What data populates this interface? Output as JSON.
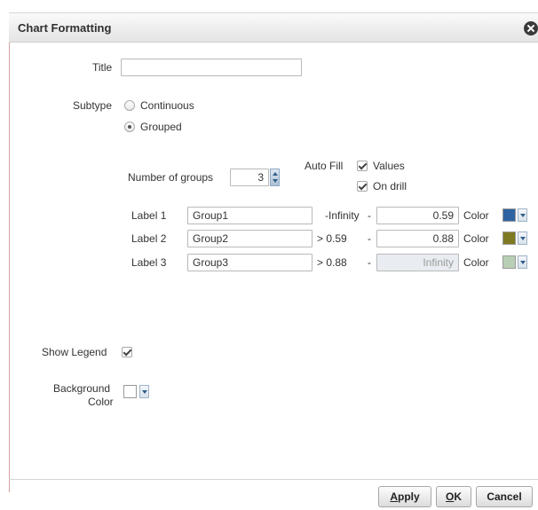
{
  "dialog": {
    "title": "Chart Formatting"
  },
  "form": {
    "title_label": "Title",
    "title_value": "",
    "subtype_label": "Subtype",
    "subtype_options": [
      "Continuous",
      "Grouped"
    ],
    "subtype_selected": "Grouped",
    "num_groups_label": "Number of groups",
    "num_groups_value": "3",
    "autofill_label": "Auto Fill",
    "autofill_values_label": "Values",
    "autofill_ondrill_label": "On drill",
    "color_label": "Color",
    "groups": [
      {
        "label": "Label 1",
        "name": "Group1",
        "lower": "-Infinity",
        "sep": "-",
        "upper": "0.59",
        "color": "#2e63a2"
      },
      {
        "label": "Label 2",
        "name": "Group2",
        "lower": "> 0.59",
        "sep": "-",
        "upper": "0.88",
        "color": "#7e7a23"
      },
      {
        "label": "Label 3",
        "name": "Group3",
        "lower": "> 0.88",
        "sep": "-",
        "upper": "Infinity",
        "color": "#b9cfb5"
      }
    ],
    "show_legend_label": "Show Legend",
    "background_color_label_1": "Background",
    "background_color_label_2": "Color",
    "background_color": "#ffffff"
  },
  "buttons": {
    "apply_first": "A",
    "apply_rest": "pply",
    "ok_first": "O",
    "ok_rest": "K",
    "cancel": "Cancel"
  }
}
